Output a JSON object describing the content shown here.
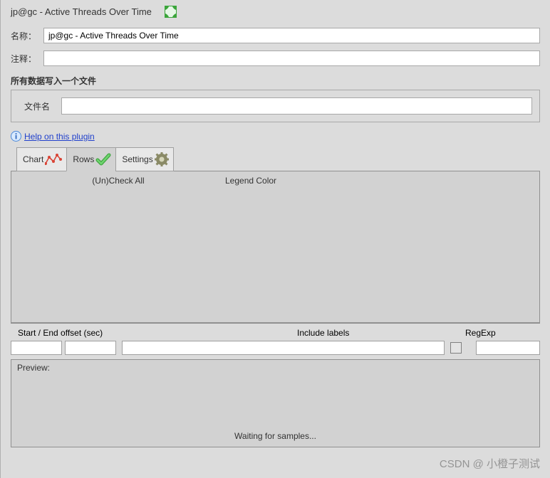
{
  "panel": {
    "title": "jp@gc - Active Threads Over Time",
    "name_label": "名称：",
    "name_value": "jp@gc - Active Threads Over Time",
    "comment_label": "注释：",
    "comment_value": "",
    "write_section_label": "所有数据写入一个文件",
    "filename_label": "文件名",
    "filename_value": "",
    "help_link_text": "Help on this plugin"
  },
  "tabs": {
    "chart": "Chart",
    "rows": "Rows",
    "settings": "Settings"
  },
  "rows_panel": {
    "col_uncheck": "(Un)Check All",
    "col_legend": "Legend Color"
  },
  "offsets": {
    "start_end_label": "Start / End offset (sec)",
    "include_label": "Include labels",
    "regexp_label": "RegExp",
    "start_value": "",
    "end_value": "",
    "include_value": "",
    "regexp_checked": false,
    "regexp_value": ""
  },
  "preview": {
    "label": "Preview:",
    "status": "Waiting for samples..."
  },
  "watermark": "CSDN @ 小橙子测试"
}
